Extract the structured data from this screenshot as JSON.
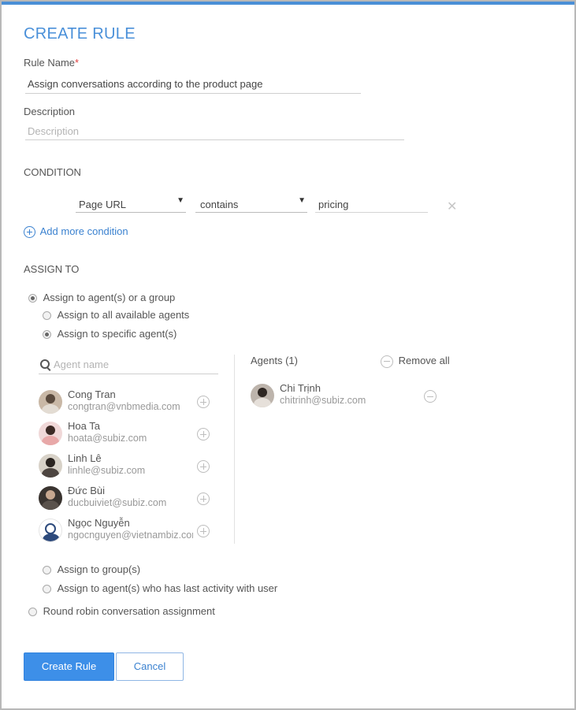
{
  "page": {
    "title": "CREATE RULE"
  },
  "rule_name": {
    "label": "Rule Name",
    "required_mark": "*",
    "value": "Assign conversations according to the product page"
  },
  "description": {
    "label": "Description",
    "placeholder": "Description"
  },
  "condition": {
    "section_label": "CONDITION",
    "field_select": "Page URL",
    "operator_select": "contains",
    "value": "pricing",
    "add_more_label": "Add more condition"
  },
  "assign_to": {
    "section_label": "ASSIGN TO",
    "options": {
      "agents_or_group": "Assign to agent(s) or a group",
      "all_available": "Assign to all available agents",
      "specific_agents": "Assign to specific agent(s)",
      "groups": "Assign to group(s)",
      "last_activity": "Assign to agent(s) who has last activity with user",
      "round_robin": "Round robin conversation assignment"
    },
    "selected": [
      "agents_or_group",
      "specific_agents"
    ]
  },
  "agent_picker": {
    "search_placeholder": "Agent name",
    "available": [
      {
        "name": "Cong Tran",
        "email": "congtran@vnbmedia.com"
      },
      {
        "name": "Hoa Ta",
        "email": "hoata@subiz.com"
      },
      {
        "name": "Linh Lê",
        "email": "linhle@subiz.com"
      },
      {
        "name": "Đức Bùi",
        "email": "ducbuiviet@subiz.com"
      },
      {
        "name": "Ngọc Nguyễn",
        "email": "ngocnguyen@vietnambiz.com"
      }
    ],
    "selected_header": "Agents (1)",
    "remove_all_label": "Remove all",
    "selected": [
      {
        "name": "Chi Trịnh",
        "email": "chitrinh@subiz.com"
      }
    ]
  },
  "actions": {
    "create_label": "Create Rule",
    "cancel_label": "Cancel"
  },
  "colors": {
    "accent": "#4a90d9",
    "primary_button": "#3d8fe8"
  }
}
